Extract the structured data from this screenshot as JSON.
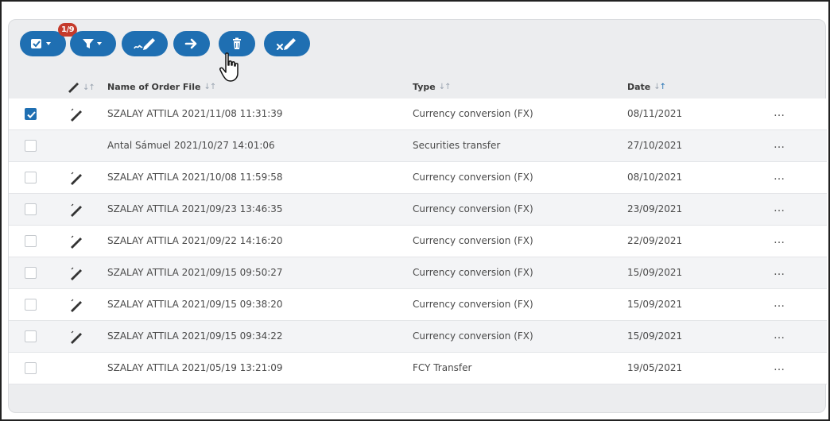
{
  "toolbar": {
    "buttons": [
      {
        "name": "select-menu-button",
        "icon": "checkbox-dropdown-icon"
      },
      {
        "name": "filter-button",
        "icon": "filter-dropdown-icon"
      },
      {
        "name": "sign-button",
        "icon": "signature-pen-icon"
      },
      {
        "name": "send-button",
        "icon": "arrow-right-icon"
      },
      {
        "name": "delete-button",
        "icon": "trash-icon"
      },
      {
        "name": "remove-signature-button",
        "icon": "pen-cross-icon"
      }
    ],
    "selection_badge": "1/9"
  },
  "colors": {
    "accent": "#1f6fb2",
    "badge": "#c53a2b"
  },
  "table": {
    "columns": {
      "signed": "",
      "name": "Name of Order File",
      "type": "Type",
      "date": "Date"
    },
    "rows": [
      {
        "checked": true,
        "signed": true,
        "name": "SZALAY ATTILA 2021/11/08 11:31:39",
        "type": "Currency conversion (FX)",
        "date": "08/11/2021",
        "more": "…"
      },
      {
        "checked": false,
        "signed": false,
        "name": "Antal Sámuel 2021/10/27 14:01:06",
        "type": "Securities transfer",
        "date": "27/10/2021",
        "more": "…"
      },
      {
        "checked": false,
        "signed": true,
        "name": "SZALAY ATTILA 2021/10/08 11:59:58",
        "type": "Currency conversion (FX)",
        "date": "08/10/2021",
        "more": "…"
      },
      {
        "checked": false,
        "signed": true,
        "name": "SZALAY ATTILA 2021/09/23 13:46:35",
        "type": "Currency conversion (FX)",
        "date": "23/09/2021",
        "more": "…"
      },
      {
        "checked": false,
        "signed": true,
        "name": "SZALAY ATTILA 2021/09/22 14:16:20",
        "type": "Currency conversion (FX)",
        "date": "22/09/2021",
        "more": "…"
      },
      {
        "checked": false,
        "signed": true,
        "name": "SZALAY ATTILA 2021/09/15 09:50:27",
        "type": "Currency conversion (FX)",
        "date": "15/09/2021",
        "more": "…"
      },
      {
        "checked": false,
        "signed": true,
        "name": "SZALAY ATTILA 2021/09/15 09:38:20",
        "type": "Currency conversion (FX)",
        "date": "15/09/2021",
        "more": "…"
      },
      {
        "checked": false,
        "signed": true,
        "name": "SZALAY ATTILA 2021/09/15 09:34:22",
        "type": "Currency conversion (FX)",
        "date": "15/09/2021",
        "more": "…"
      },
      {
        "checked": false,
        "signed": false,
        "name": "SZALAY ATTILA 2021/05/19 13:21:09",
        "type": "FCY Transfer",
        "date": "19/05/2021",
        "more": "…"
      }
    ]
  }
}
